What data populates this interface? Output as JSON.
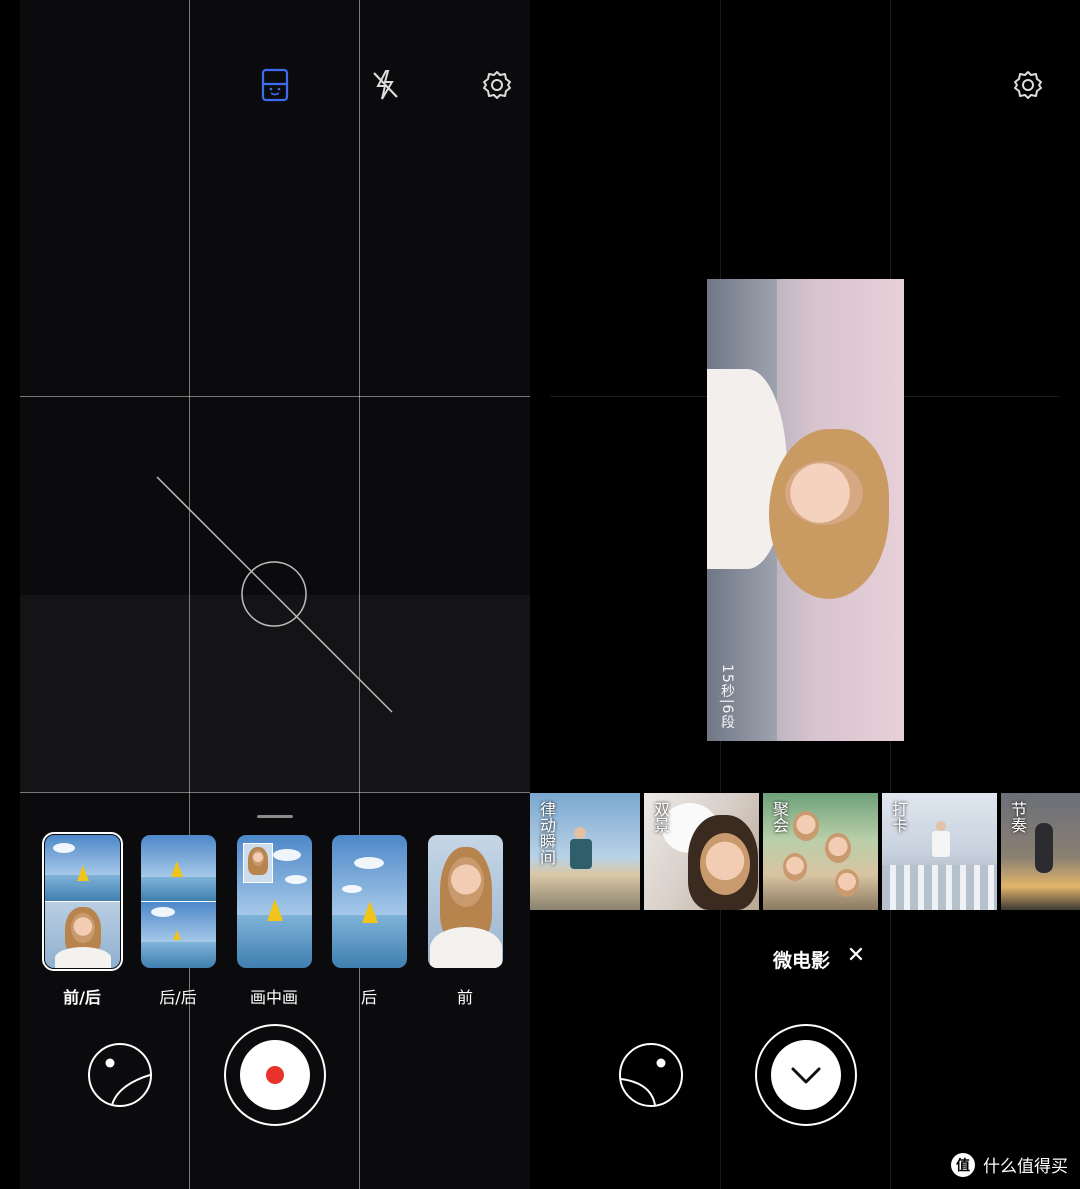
{
  "left": {
    "top_icons": [
      "portrait-mode-icon",
      "flash-off-icon",
      "gear-icon"
    ],
    "accent_color": "#3d6cf0",
    "dual_modes": [
      {
        "label": "前/后",
        "selected": true
      },
      {
        "label": "后/后",
        "selected": false
      },
      {
        "label": "画中画",
        "selected": false
      },
      {
        "label": "后",
        "selected": false
      },
      {
        "label": "前",
        "selected": false
      }
    ],
    "record_color": "#e8322a"
  },
  "right": {
    "top_icons": [
      "gear-icon"
    ],
    "preview_duration": "15秒|6段",
    "templates": [
      {
        "label": "律动瞬间"
      },
      {
        "label": "双景"
      },
      {
        "label": "聚会"
      },
      {
        "label": "打卡"
      },
      {
        "label": "节奏"
      }
    ],
    "mode_title": "微电影",
    "close_symbol": "✕"
  },
  "watermark": {
    "logo": "值",
    "text": "什么值得买"
  }
}
